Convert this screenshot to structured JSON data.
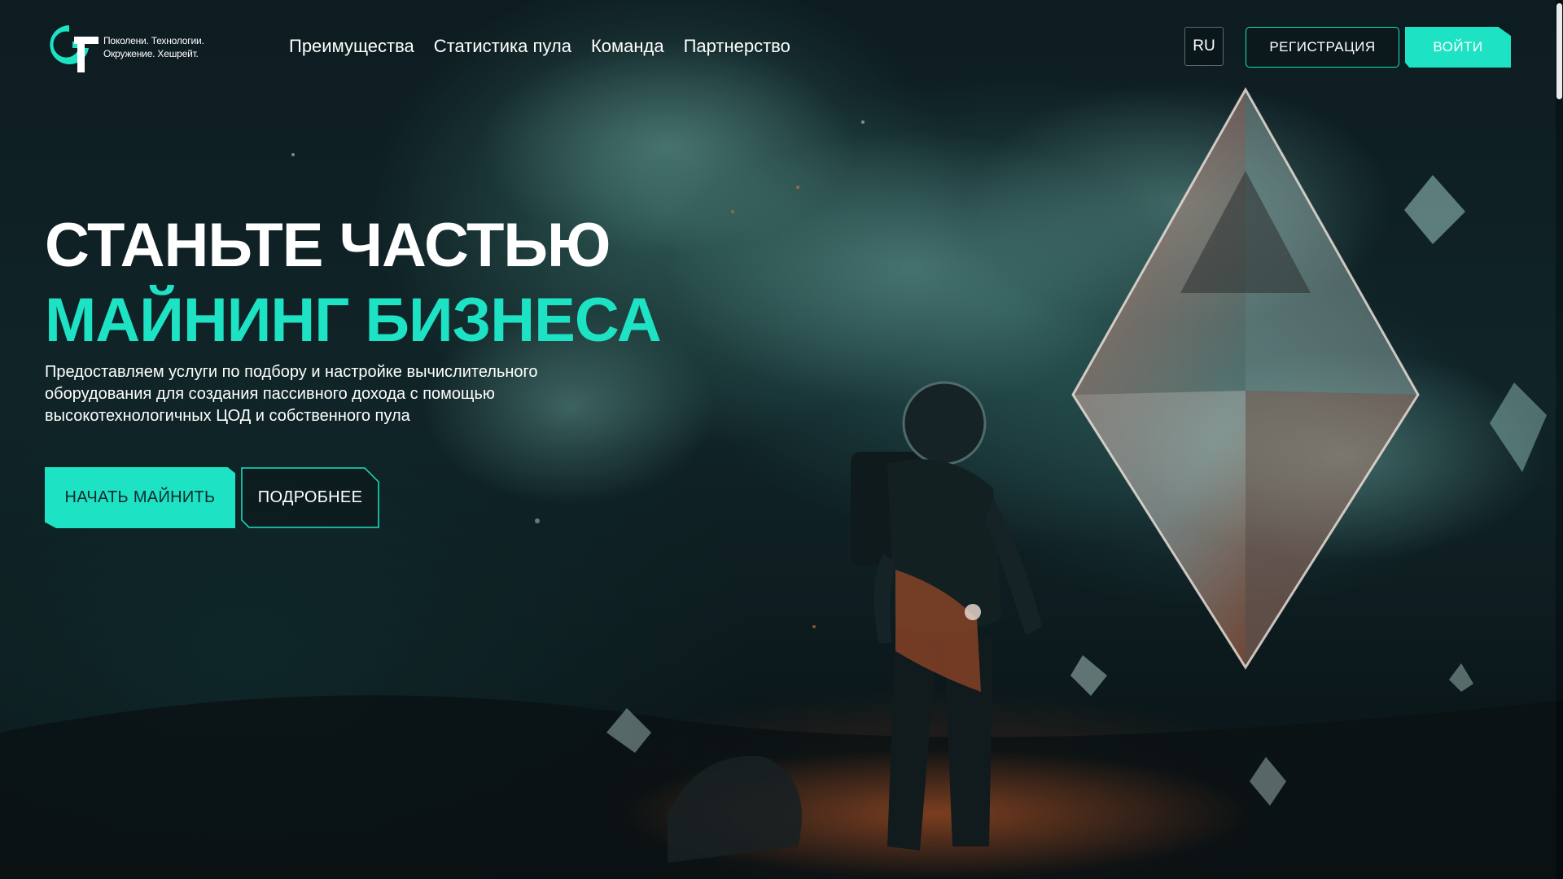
{
  "brand": {
    "tagline_line1": "Поколени. Технологии.",
    "tagline_line2": "Окружение. Хешрейт.",
    "accent_color": "#1de2c4"
  },
  "nav": {
    "items": [
      "Преимущества",
      "Статистика пула",
      "Команда",
      "Партнерство"
    ]
  },
  "header": {
    "language": "RU",
    "register_label": "РЕГИСТРАЦИЯ",
    "login_label": "ВОЙТИ"
  },
  "hero": {
    "title_line1": "СТАНЬТЕ ЧАСТЬЮ",
    "title_line2": "МАЙНИНГ БИЗНЕСА",
    "description": "Предоставляем услуги по подбору и настройке вычислительного оборудования для создания пассивного дохода с помощью высокотехнологичных ЦОД и собственного пула",
    "start_label": "НАЧАТЬ МАЙНИТЬ",
    "more_label": "ПОДРОБНЕЕ"
  }
}
